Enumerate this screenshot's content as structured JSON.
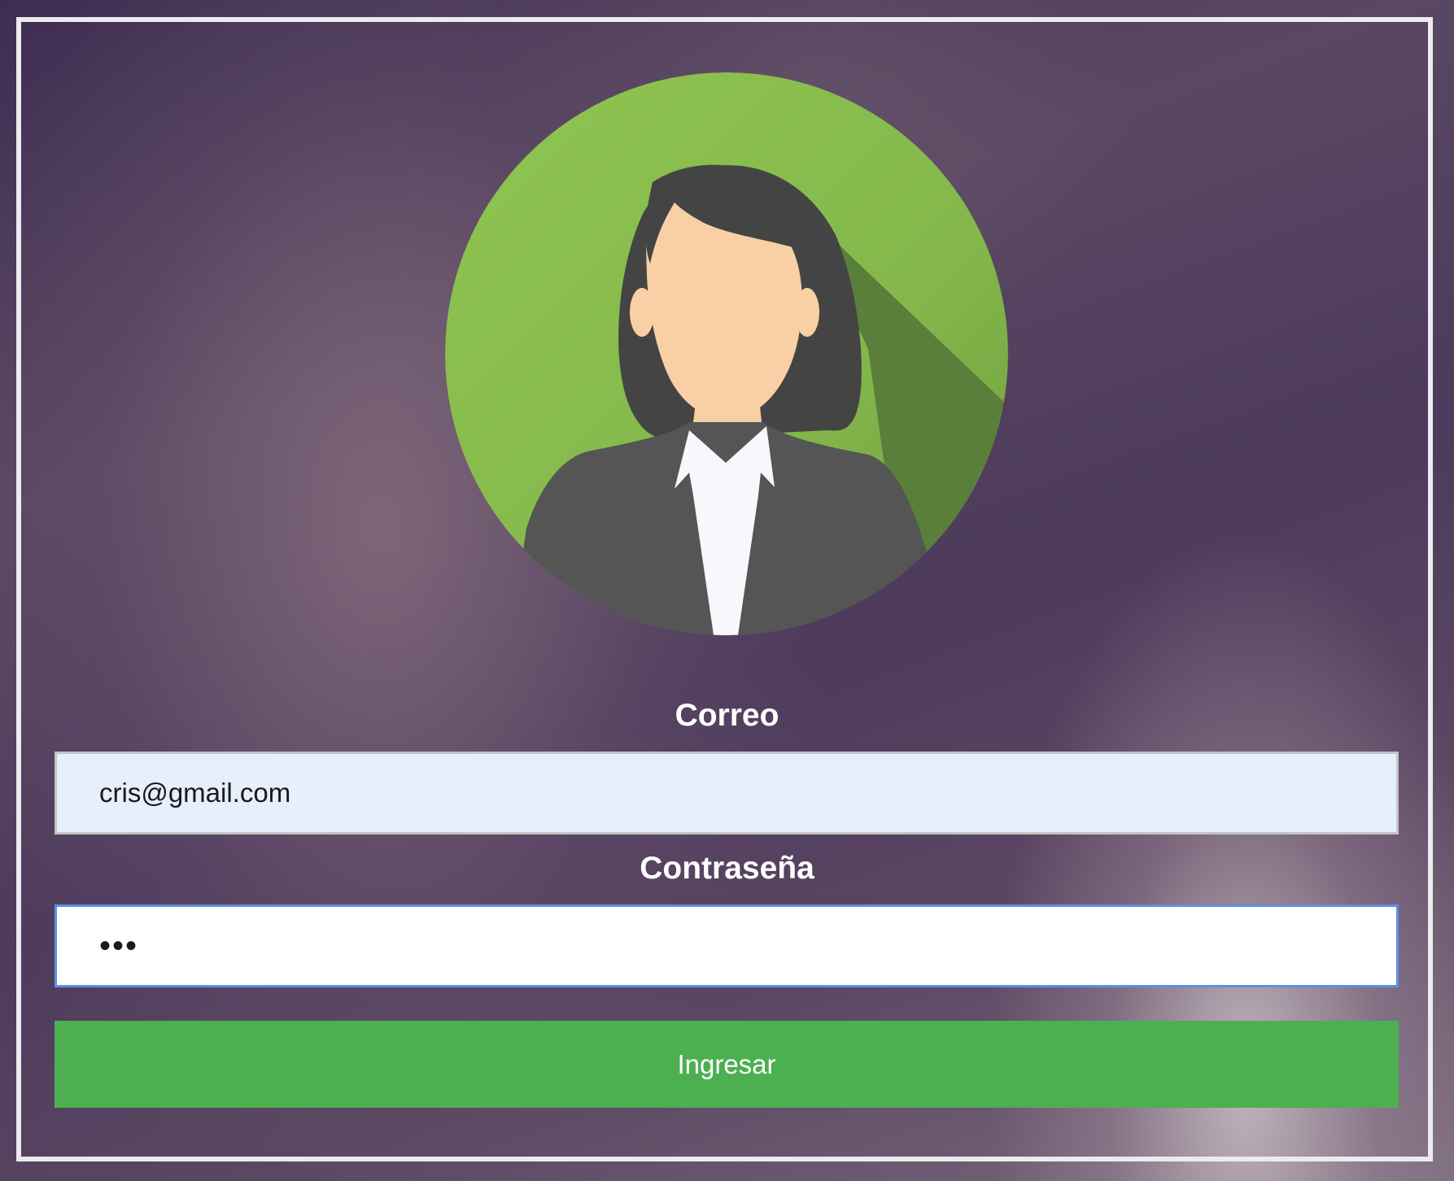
{
  "login": {
    "avatar_icon": "woman-avatar-icon",
    "email_label": "Correo",
    "email_value": "cris@gmail.com",
    "password_label": "Contraseña",
    "password_value": "•••",
    "submit_label": "Ingresar"
  },
  "colors": {
    "accent": "#4caf50",
    "avatar_circle": "#8bc34a",
    "input_focus_border": "#5b8fe6",
    "email_autofill_bg": "#e8effc"
  }
}
